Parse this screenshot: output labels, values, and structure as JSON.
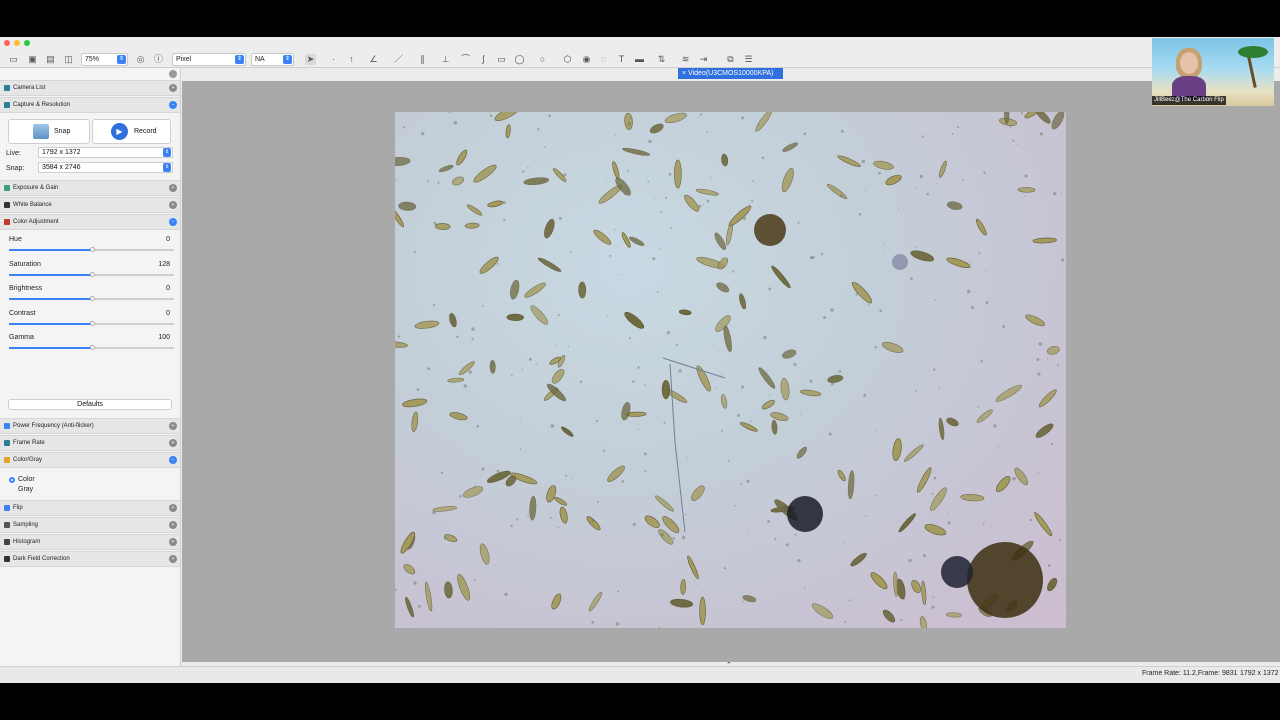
{
  "toolbar": {
    "zoom": "75%",
    "unit": "Pixel",
    "magnification": "NA"
  },
  "doc_tab": {
    "close": "×",
    "label": "Video(U3CMOS10000KPA)"
  },
  "sidebar": {
    "sections_top": [
      {
        "label": "Camera List",
        "color": "#2a7f94",
        "open": false
      },
      {
        "label": "Capture & Resolution",
        "color": "#2a7f94",
        "open": true
      }
    ],
    "capture": {
      "snap_label": "Snap",
      "record_label": "Record",
      "live_label": "Live:",
      "live_value": "1792 x 1372",
      "snap_res_label": "Snap:",
      "snap_value": "3584 x 2746"
    },
    "sections_mid": [
      {
        "label": "Exposure & Gain",
        "color": "#3aa07a",
        "open": false
      },
      {
        "label": "White Balance",
        "color": "#333333",
        "open": false
      },
      {
        "label": "Color Adjustment",
        "color": "#c0392b",
        "open": true
      }
    ],
    "color_adjustment": [
      {
        "label": "Hue",
        "value": "0",
        "level": 0.5
      },
      {
        "label": "Saturation",
        "value": "128",
        "level": 0.5
      },
      {
        "label": "Brightness",
        "value": "0",
        "level": 0.5
      },
      {
        "label": "Contrast",
        "value": "0",
        "level": 0.5
      },
      {
        "label": "Gamma",
        "value": "100",
        "level": 0.5
      }
    ],
    "defaults_label": "Defaults",
    "sections_low": [
      {
        "label": "Power Frequency (Anti-flicker)",
        "color": "#3b82f6",
        "open": false
      },
      {
        "label": "Frame Rate",
        "color": "#2a7f94",
        "open": false
      },
      {
        "label": "Color/Gray",
        "color": "#e0a526",
        "open": true
      }
    ],
    "color_gray": {
      "color_label": "Color",
      "gray_label": "Gray",
      "selected": "Color"
    },
    "sections_bottom": [
      {
        "label": "Flip",
        "color": "#3b82f6",
        "open": false
      },
      {
        "label": "Sampling",
        "color": "#555555",
        "open": false
      },
      {
        "label": "Histogram",
        "color": "#444444",
        "open": false
      },
      {
        "label": "Dark Field Correction",
        "color": "#333333",
        "open": false
      }
    ]
  },
  "status": {
    "frame_info": "Frame Rate: 11.2,Frame: 9831",
    "resolution": "1792 x 1372"
  },
  "webcam": {
    "name": "JillBeez@The Carbon Flip"
  }
}
